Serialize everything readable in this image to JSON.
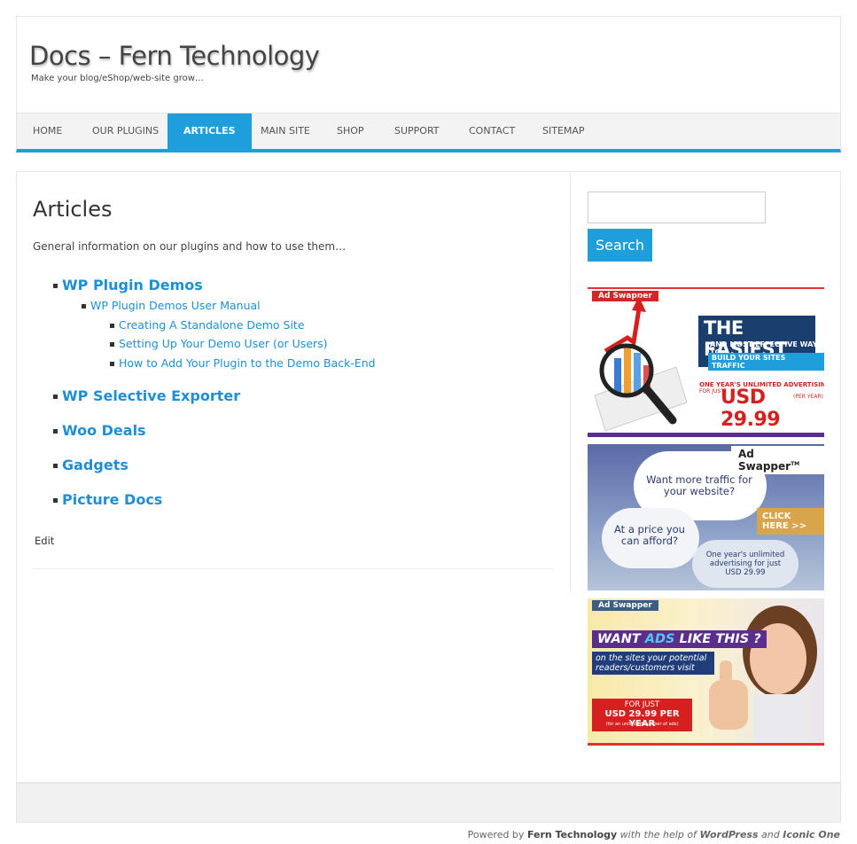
{
  "header": {
    "title": "Docs – Fern Technology",
    "description": "Make your blog/eShop/web-site grow…"
  },
  "nav": [
    {
      "label": "HOME"
    },
    {
      "label": "OUR PLUGINS"
    },
    {
      "label": "ARTICLES",
      "active": true
    },
    {
      "label": "MAIN SITE"
    },
    {
      "label": "SHOP"
    },
    {
      "label": "SUPPORT"
    },
    {
      "label": "CONTACT"
    },
    {
      "label": "SITEMAP"
    }
  ],
  "page": {
    "title": "Articles",
    "intro": "General information on our plugins and how to use them…",
    "tree": {
      "wp_plugin_demos": "WP Plugin Demos",
      "user_manual": "WP Plugin Demos User Manual",
      "creating_site": "Creating A Standalone Demo Site",
      "setting_up_user": "Setting Up Your Demo User (or Users)",
      "add_plugin": "How to Add Your Plugin to the Demo Back-End",
      "selective_exporter": "WP Selective Exporter",
      "woo_deals": "Woo Deals",
      "gadgets": "Gadgets",
      "picture_docs": "Picture Docs"
    },
    "edit_label": "Edit"
  },
  "sidebar": {
    "search_placeholder": "",
    "search_button": "Search",
    "ads": {
      "ad1": {
        "tag": "Ad Swapper",
        "headline": "THE EASIEST",
        "sub1": "AND MOST EFFECTIVE WAY TO",
        "sub2": "BUILD YOUR SITES TRAFFIC",
        "offer": "ONE YEAR'S UNLIMITED ADVERTISING",
        "for_just": "FOR JUST",
        "price": "USD 29.99",
        "per_year": "(PER YEAR)"
      },
      "ad2": {
        "brand": "Ad Swapper",
        "tm": "TM",
        "cloud1": "Want more traffic for your website?",
        "cloud2": "At a price you can afford?",
        "cloud3": "One year's unlimited advertising for just USD 29.99",
        "cta": "CLICK HERE >>"
      },
      "ad3": {
        "tag": "Ad Swapper",
        "headline_a": "WANT ",
        "headline_b": "ADS",
        "headline_c": " LIKE THIS ?",
        "sub": "on the sites your potential readers/customers visit",
        "for_just": "FOR JUST",
        "price": "USD 29.99 PER YEAR",
        "fine": "(for an unlimited number of ads)"
      }
    }
  },
  "footer": {
    "powered_by": "Powered by",
    "company": "Fern Technology",
    "with_help": "with the help of",
    "wp": "WordPress",
    "and": "and",
    "theme": "Iconic One"
  },
  "colors": {
    "accent": "#1e9fdc",
    "link": "#1e8fd6"
  }
}
